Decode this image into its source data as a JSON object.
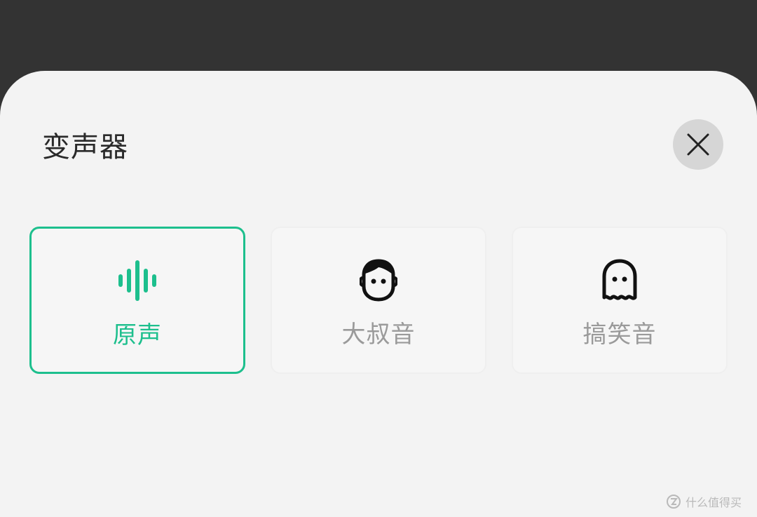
{
  "sheet": {
    "title": "变声器",
    "close_icon": "close-icon"
  },
  "options": [
    {
      "label": "原声",
      "icon": "waveform-icon",
      "selected": true
    },
    {
      "label": "大叔音",
      "icon": "uncle-face-icon",
      "selected": false
    },
    {
      "label": "搞笑音",
      "icon": "ghost-icon",
      "selected": false
    }
  ],
  "watermark": {
    "text": "什么值得买"
  },
  "colors": {
    "accent": "#1dbf8d",
    "backdrop": "#333333",
    "sheet_bg": "#f3f3f3",
    "close_bg": "#d6d6d6",
    "unselected_text": "#9a9a9a"
  }
}
